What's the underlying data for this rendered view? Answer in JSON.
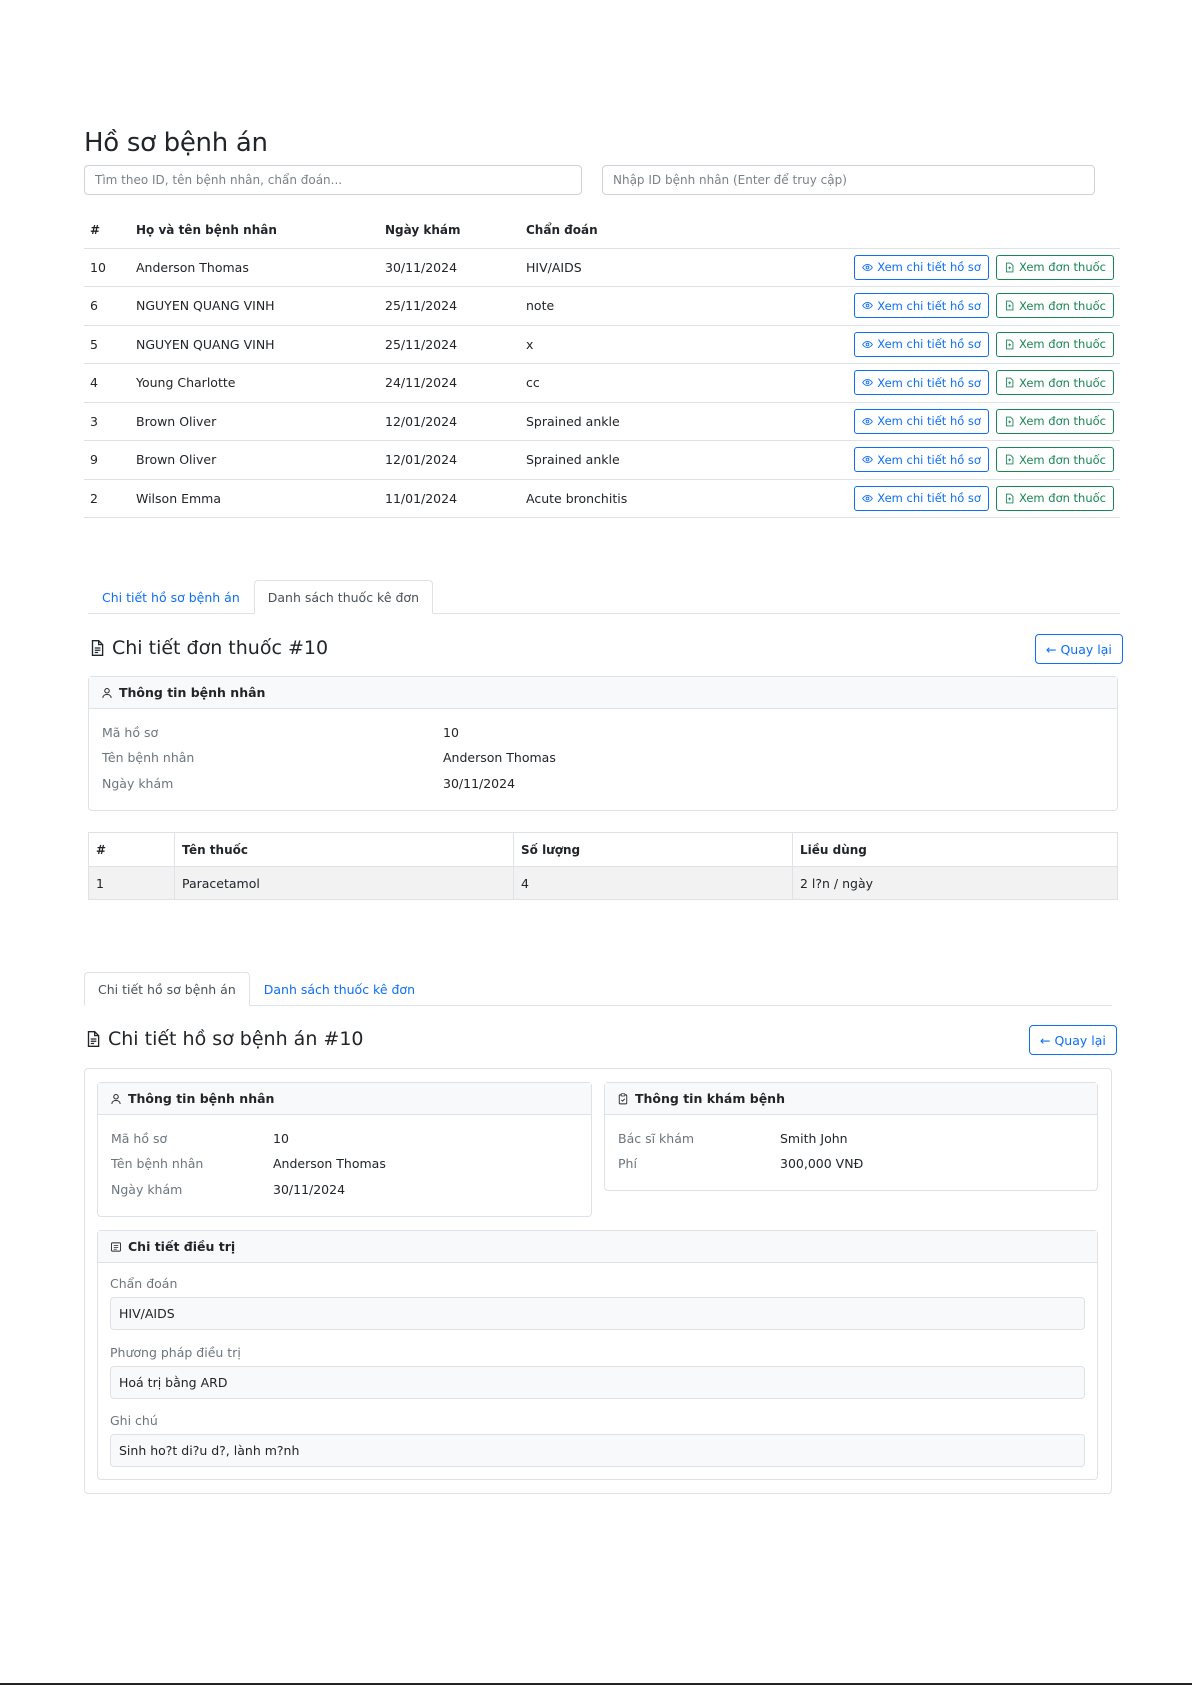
{
  "page_title": "Hồ sơ bệnh án",
  "search": {
    "query_placeholder": "Tìm theo ID, tên bệnh nhân, chẩn đoán...",
    "patient_id_placeholder": "Nhập ID bệnh nhân (Enter để truy cập)"
  },
  "records_table": {
    "headers": [
      "#",
      "Họ và tên bệnh nhân",
      "Ngày khám",
      "Chẩn đoán"
    ],
    "view_record_label": "Xem chi tiết hồ sơ",
    "view_prescription_label": "Xem đơn thuốc",
    "rows": [
      {
        "id": "10",
        "name": "Anderson Thomas",
        "date": "30/11/2024",
        "diagnosis": "HIV/AIDS"
      },
      {
        "id": "6",
        "name": "NGUYEN QUANG VINH",
        "date": "25/11/2024",
        "diagnosis": "note"
      },
      {
        "id": "5",
        "name": "NGUYEN QUANG VINH",
        "date": "25/11/2024",
        "diagnosis": "x"
      },
      {
        "id": "4",
        "name": "Young Charlotte",
        "date": "24/11/2024",
        "diagnosis": "cc"
      },
      {
        "id": "3",
        "name": "Brown Oliver",
        "date": "12/01/2024",
        "diagnosis": "Sprained ankle"
      },
      {
        "id": "9",
        "name": "Brown Oliver",
        "date": "12/01/2024",
        "diagnosis": "Sprained ankle"
      },
      {
        "id": "2",
        "name": "Wilson Emma",
        "date": "11/01/2024",
        "diagnosis": "Acute bronchitis"
      }
    ]
  },
  "tabs": {
    "record_detail": "Chi tiết hồ sơ bệnh án",
    "prescription_list": "Danh sách thuốc kê đơn"
  },
  "back_label": "← Quay lại",
  "prescription_section": {
    "title": "Chi tiết đơn thuốc #10",
    "patient_card_title": "Thông tin bệnh nhân",
    "fields": [
      {
        "label": "Mã hồ sơ",
        "value": "10"
      },
      {
        "label": "Tên bệnh nhân",
        "value": "Anderson Thomas"
      },
      {
        "label": "Ngày khám",
        "value": "30/11/2024"
      }
    ],
    "meds_headers": [
      "#",
      "Tên thuốc",
      "Số lượng",
      "Liều dùng"
    ],
    "meds_rows": [
      {
        "no": "1",
        "name": "Paracetamol",
        "qty": "4",
        "dosage": "2 l?n / ngày"
      }
    ]
  },
  "record_section": {
    "title": "Chi tiết hồ sơ bệnh án #10",
    "patient_card_title": "Thông tin bệnh nhân",
    "patient_fields": [
      {
        "label": "Mã hồ sơ",
        "value": "10"
      },
      {
        "label": "Tên bệnh nhân",
        "value": "Anderson Thomas"
      },
      {
        "label": "Ngày khám",
        "value": "30/11/2024"
      }
    ],
    "exam_card_title": "Thông tin khám bệnh",
    "exam_fields": [
      {
        "label": "Bác sĩ khám",
        "value": "Smith John"
      },
      {
        "label": "Phí",
        "value": "300,000 VNĐ"
      }
    ],
    "treatment_card_title": "Chi tiết điều trị",
    "diagnosis_label": "Chẩn đoán",
    "diagnosis_value": "HIV/AIDS",
    "method_label": "Phương pháp điều trị",
    "method_value": "Hoá trị bằng ARD",
    "note_label": "Ghi chú",
    "note_value": "Sinh ho?t di?u d?, lành m?nh"
  }
}
